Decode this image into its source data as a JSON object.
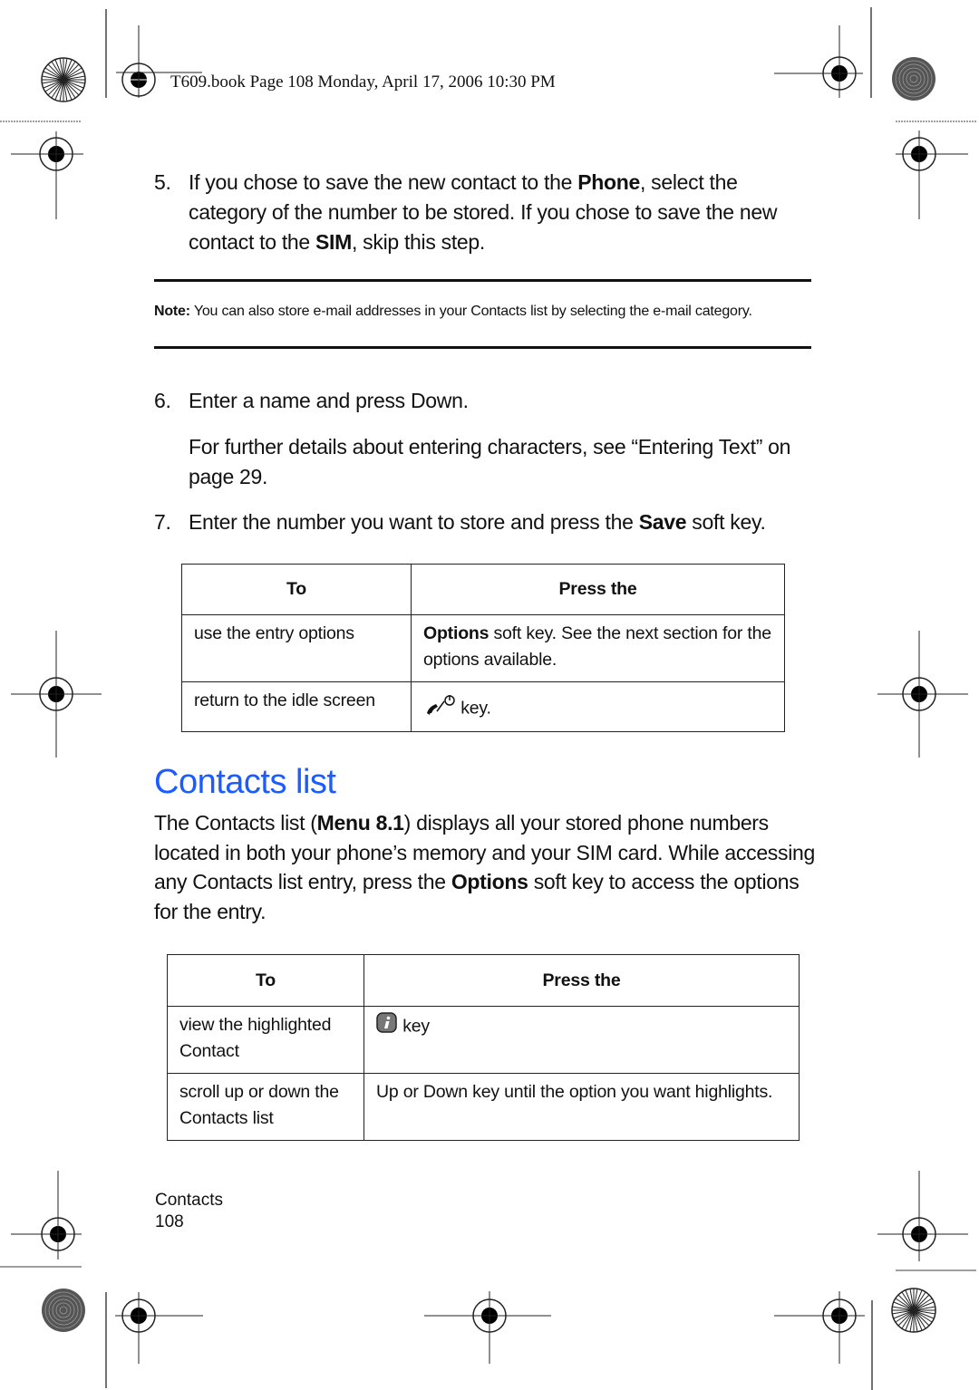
{
  "header": {
    "text": "T609.book  Page 108  Monday, April 17, 2006  10:30 PM"
  },
  "step5": {
    "number": "5.",
    "part1": "If you chose to save the new contact to the ",
    "bold1": "Phone",
    "part2": ", select the category of the number to be stored. If you chose to save the new contact to the ",
    "bold2": "SIM",
    "part3": ", skip this step."
  },
  "note": {
    "label": "Note:",
    "text": " You can also store e-mail addresses in your Contacts list by selecting the e-mail category."
  },
  "step6": {
    "number": "6.",
    "text": "Enter a name and press Down.",
    "subtext": "For further details about entering characters, see “Entering Text” on page 29."
  },
  "step7": {
    "number": "7.",
    "part1": "Enter the number you want to store and press the ",
    "bold1": "Save",
    "part2": " soft key."
  },
  "table1": {
    "headers": [
      "To",
      "Press the"
    ],
    "rows": [
      {
        "to": "use the entry options",
        "press_bold": "Options",
        "press_text": " soft key. See the next section for the options available."
      },
      {
        "to": "return to the idle screen",
        "press_icon": "end-power-key-icon",
        "press_text": " key."
      }
    ]
  },
  "section": {
    "heading": "Contacts list",
    "heading_color": "#1a5cff",
    "para_part1": "The Contacts list (",
    "para_bold1": "Menu 8.1",
    "para_part2": ") displays all your stored phone numbers located in both your phone’s memory and your SIM card. While accessing any Contacts list entry, press the ",
    "para_bold2": "Options",
    "para_part3": " soft key to access the options for the entry."
  },
  "table2": {
    "headers": [
      "To",
      "Press the"
    ],
    "rows": [
      {
        "to": "view the highlighted Contact",
        "press_icon": "info-key-icon",
        "press_text": " key"
      },
      {
        "to": "scroll up or down the Contacts list",
        "press_text": "Up or Down key until the option you want highlights."
      }
    ]
  },
  "footer": {
    "section": "Contacts",
    "page": "108"
  }
}
